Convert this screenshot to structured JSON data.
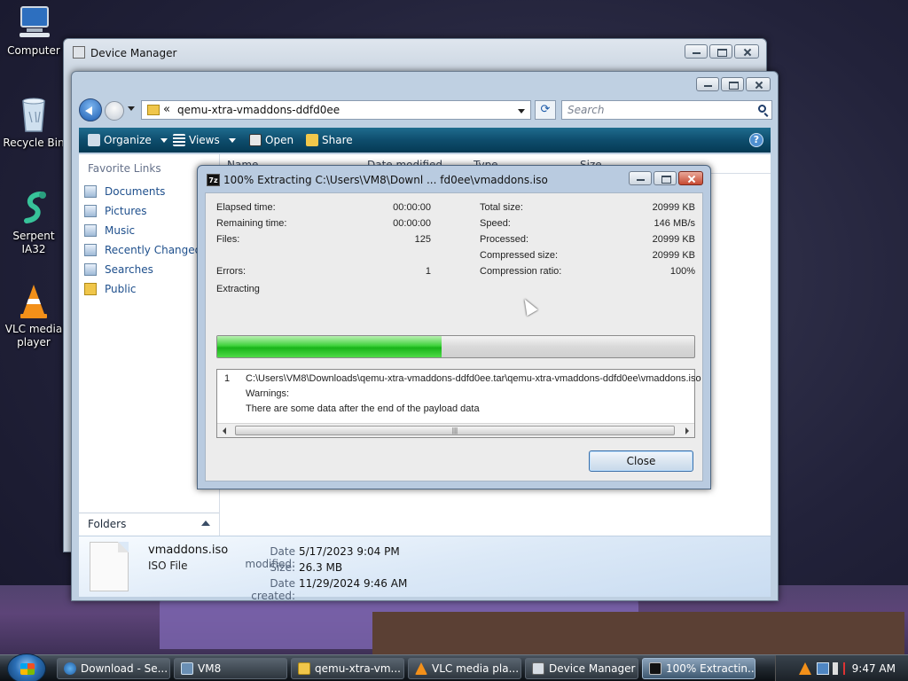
{
  "desktop": {
    "icons": [
      {
        "label": "Computer",
        "icon": "computer-icon"
      },
      {
        "label": "Recycle Bin",
        "icon": "recycle-bin-icon"
      },
      {
        "label": "Serpent IA32",
        "icon": "serpent-icon"
      },
      {
        "label": "VLC media player",
        "icon": "vlc-icon"
      }
    ]
  },
  "device_manager": {
    "title": "Device Manager"
  },
  "explorer": {
    "address_path": "qemu-xtra-vmaddons-ddfd0ee",
    "address_prefix": "«",
    "search_placeholder": "Search",
    "toolbar": {
      "organize": "Organize",
      "views": "Views",
      "open": "Open",
      "share": "Share",
      "help": "?"
    },
    "favorite_links_heading": "Favorite Links",
    "favorite_links": [
      "Documents",
      "Pictures",
      "Music",
      "Recently Changed",
      "Searches",
      "Public"
    ],
    "folders_label": "Folders",
    "columns": [
      "Name",
      "Date modified",
      "Type",
      "Size"
    ],
    "details": {
      "file_name": "vmaddons.iso",
      "file_type": "ISO File",
      "date_modified_label": "Date modified:",
      "date_modified": "5/17/2023 9:04 PM",
      "size_label": "Size:",
      "size": "26.3 MB",
      "date_created_label": "Date created:",
      "date_created": "11/29/2024 9:46 AM"
    }
  },
  "zip_dialog": {
    "title": "100% Extracting C:\\Users\\VM8\\Downl ... fd0ee\\vmaddons.iso",
    "app_icon_text": "7z",
    "left_stats": [
      {
        "label": "Elapsed time:",
        "value": "00:00:00"
      },
      {
        "label": "Remaining time:",
        "value": "00:00:00"
      },
      {
        "label": "Files:",
        "value": "125"
      },
      {
        "label": "Errors:",
        "value": "1"
      }
    ],
    "right_stats": [
      {
        "label": "Total size:",
        "value": "20999 KB"
      },
      {
        "label": "Speed:",
        "value": "146 MB/s"
      },
      {
        "label": "Processed:",
        "value": "20999 KB"
      },
      {
        "label": "Compressed size:",
        "value": "20999 KB"
      },
      {
        "label": "Compression ratio:",
        "value": "100%"
      }
    ],
    "status": "Extracting",
    "progress_fraction": 0.47,
    "messages": {
      "index": "1",
      "path": "C:\\Users\\VM8\\Downloads\\qemu-xtra-vmaddons-ddfd0ee.tar\\qemu-xtra-vmaddons-ddfd0ee\\vmaddons.iso",
      "warnings_label": "Warnings:",
      "warning_text": "There are some data after the end of the payload data"
    },
    "close_label": "Close"
  },
  "taskbar": {
    "items": [
      {
        "label": "Download - Se...",
        "icon": "browser-icon"
      },
      {
        "label": "VM8",
        "icon": "window-icon"
      },
      {
        "label": "qemu-xtra-vm...",
        "icon": "folder-icon"
      },
      {
        "label": "VLC media pla...",
        "icon": "vlc-icon"
      },
      {
        "label": "Device Manager",
        "icon": "device-manager-icon"
      },
      {
        "label": "100% Extractin...",
        "icon": "7zip-icon"
      }
    ],
    "clock": "9:47 AM"
  },
  "colors": {
    "progress_green": "#18b419",
    "command_bar": "#0e4d6d",
    "link_blue": "#1e4f8c"
  }
}
